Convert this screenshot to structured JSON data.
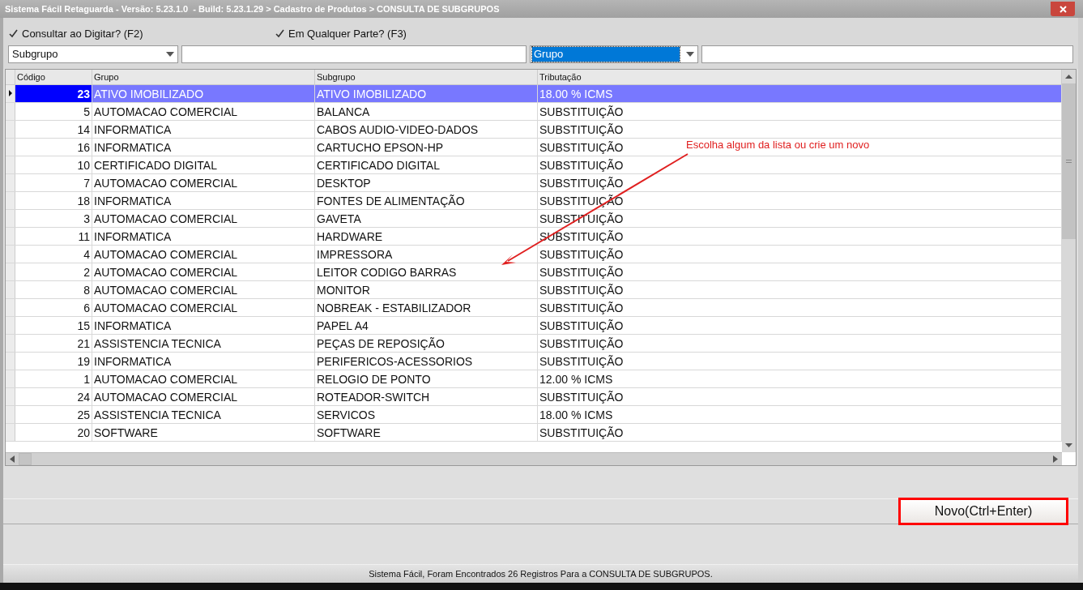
{
  "window": {
    "title": "Sistema Fácil Retaguarda - Versão: 5.23.1.0  - Build: 5.23.1.29 > Cadastro de Produtos > CONSULTA DE SUBGRUPOS"
  },
  "options": [
    {
      "label": "Consultar ao Digitar? (F2)",
      "checked": true
    },
    {
      "label": "Em Qualquer Parte? (F3)",
      "checked": true
    }
  ],
  "filters": [
    {
      "field": "Subgrupo",
      "focused": false
    },
    {
      "field": "Grupo",
      "focused": true
    }
  ],
  "table": {
    "columns": [
      "Código",
      "Grupo",
      "Subgrupo",
      "Tributação"
    ],
    "rows": [
      {
        "cells": [
          "23",
          "ATIVO IMOBILIZADO",
          "ATIVO IMOBILIZADO",
          "18.00 % ICMS"
        ],
        "selected": true
      },
      {
        "cells": [
          "5",
          "AUTOMACAO COMERCIAL",
          "BALANCA",
          "SUBSTITUIÇÃO"
        ],
        "selected": false
      },
      {
        "cells": [
          "14",
          "INFORMATICA",
          "CABOS AUDIO-VIDEO-DADOS",
          "SUBSTITUIÇÃO"
        ],
        "selected": false
      },
      {
        "cells": [
          "16",
          "INFORMATICA",
          "CARTUCHO EPSON-HP",
          "SUBSTITUIÇÃO"
        ],
        "selected": false
      },
      {
        "cells": [
          "10",
          "CERTIFICADO DIGITAL",
          "CERTIFICADO DIGITAL",
          "SUBSTITUIÇÃO"
        ],
        "selected": false
      },
      {
        "cells": [
          "7",
          "AUTOMACAO COMERCIAL",
          "DESKTOP",
          "SUBSTITUIÇÃO"
        ],
        "selected": false
      },
      {
        "cells": [
          "18",
          "INFORMATICA",
          "FONTES DE ALIMENTAÇÃO",
          "SUBSTITUIÇÃO"
        ],
        "selected": false
      },
      {
        "cells": [
          "3",
          "AUTOMACAO COMERCIAL",
          "GAVETA",
          "SUBSTITUIÇÃO"
        ],
        "selected": false
      },
      {
        "cells": [
          "11",
          "INFORMATICA",
          "HARDWARE",
          "SUBSTITUIÇÃO"
        ],
        "selected": false
      },
      {
        "cells": [
          "4",
          "AUTOMACAO COMERCIAL",
          "IMPRESSORA",
          "SUBSTITUIÇÃO"
        ],
        "selected": false
      },
      {
        "cells": [
          "2",
          "AUTOMACAO COMERCIAL",
          "LEITOR CODIGO BARRAS",
          "SUBSTITUIÇÃO"
        ],
        "selected": false
      },
      {
        "cells": [
          "8",
          "AUTOMACAO COMERCIAL",
          "MONITOR",
          "SUBSTITUIÇÃO"
        ],
        "selected": false
      },
      {
        "cells": [
          "6",
          "AUTOMACAO COMERCIAL",
          "NOBREAK - ESTABILIZADOR",
          "SUBSTITUIÇÃO"
        ],
        "selected": false
      },
      {
        "cells": [
          "15",
          "INFORMATICA",
          "PAPEL A4",
          "SUBSTITUIÇÃO"
        ],
        "selected": false
      },
      {
        "cells": [
          "21",
          "ASSISTENCIA TECNICA",
          "PEÇAS DE REPOSIÇÃO",
          "SUBSTITUIÇÃO"
        ],
        "selected": false
      },
      {
        "cells": [
          "19",
          "INFORMATICA",
          "PERIFERICOS-ACESSORIOS",
          "SUBSTITUIÇÃO"
        ],
        "selected": false
      },
      {
        "cells": [
          "1",
          "AUTOMACAO COMERCIAL",
          "RELOGIO DE PONTO",
          "12.00 % ICMS"
        ],
        "selected": false
      },
      {
        "cells": [
          "24",
          "AUTOMACAO COMERCIAL",
          "ROTEADOR-SWITCH",
          "SUBSTITUIÇÃO"
        ],
        "selected": false
      },
      {
        "cells": [
          "25",
          "ASSISTENCIA TECNICA",
          "SERVICOS",
          "18.00 % ICMS"
        ],
        "selected": false
      },
      {
        "cells": [
          "20",
          "SOFTWARE",
          "SOFTWARE",
          "SUBSTITUIÇÃO"
        ],
        "selected": false
      }
    ]
  },
  "annotation": {
    "text": "Escolha algum da lista ou crie um novo"
  },
  "new_button": {
    "label": "Novo(Ctrl+Enter)"
  },
  "status_bar": {
    "text": "Sistema Fácil, Foram Encontrados 26 Registros Para a CONSULTA DE SUBGRUPOS."
  }
}
